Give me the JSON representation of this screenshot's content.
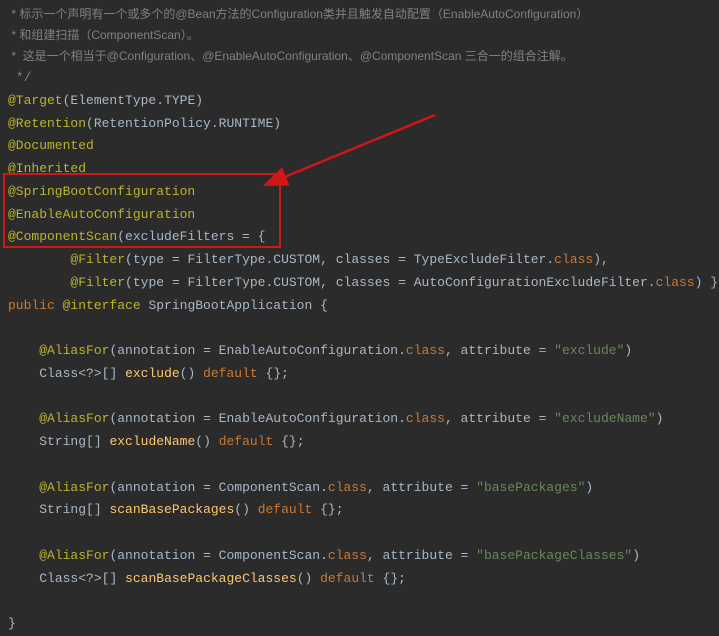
{
  "comments": {
    "l1": " * 标示一个声明有一个或多个的@Bean方法的Configuration类并且触发自动配置（EnableAutoConfiguration）",
    "l2": " * 和组建扫描（ComponentScan）。",
    "l3": " *  这是一个相当于@Configuration、@EnableAutoConfiguration、@ComponentScan 三合一的组合注解。",
    "l4": " */"
  },
  "annotations": {
    "target": "@Target",
    "retention": "@Retention",
    "documented": "@Documented",
    "inherited": "@Inherited",
    "springBootConfig": "@SpringBootConfiguration",
    "enableAutoConfig": "@EnableAutoConfiguration",
    "componentScan": "@ComponentScan",
    "filter": "@Filter",
    "aliasFor": "@AliasFor",
    "interface": "@interface"
  },
  "types": {
    "elementType": "ElementType",
    "typeVal": "TYPE",
    "retentionPolicy": "RetentionPolicy",
    "runtime": "RUNTIME",
    "filterType": "FilterType",
    "custom": "CUSTOM",
    "typeExcludeFilter": "TypeExcludeFilter",
    "autoConfigExcludeFilter": "AutoConfigurationExcludeFilter",
    "enableAutoConfiguration": "EnableAutoConfiguration",
    "componentScan": "ComponentScan",
    "classType": "Class",
    "stringArr": "String"
  },
  "keywords": {
    "public": "public",
    "default": "default",
    "class": "class"
  },
  "identifiers": {
    "springBootApplication": "SpringBootApplication",
    "excludeFilters": "excludeFilters",
    "type": "type",
    "classes": "classes",
    "annotation": "annotation",
    "attribute": "attribute"
  },
  "methods": {
    "exclude": "exclude",
    "excludeName": "excludeName",
    "scanBasePackages": "scanBasePackages",
    "scanBasePackageClasses": "scanBasePackageClasses"
  },
  "strings": {
    "exclude": "\"exclude\"",
    "excludeName": "\"excludeName\"",
    "basePackages": "\"basePackages\"",
    "basePackageClasses": "\"basePackageClasses\""
  }
}
